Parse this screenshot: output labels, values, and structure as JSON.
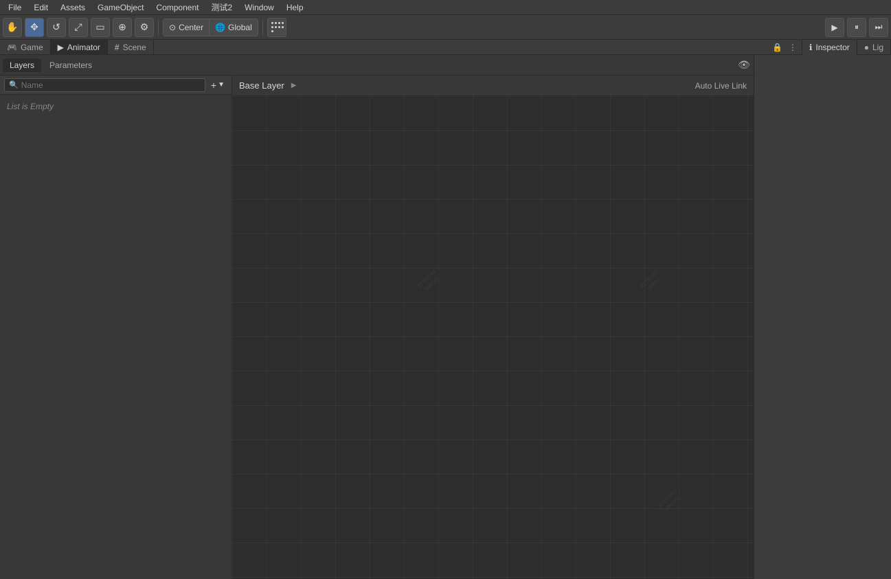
{
  "menubar": {
    "items": [
      "File",
      "Edit",
      "Assets",
      "GameObject",
      "Component",
      "测试2",
      "Window",
      "Help"
    ]
  },
  "toolbar": {
    "tools": [
      {
        "name": "hand",
        "icon": "✋",
        "tooltip": "Hand Tool"
      },
      {
        "name": "move",
        "icon": "✥",
        "tooltip": "Move Tool"
      },
      {
        "name": "rotate",
        "icon": "↺",
        "tooltip": "Rotate Tool"
      },
      {
        "name": "scale",
        "icon": "⤢",
        "tooltip": "Scale Tool"
      },
      {
        "name": "rect",
        "icon": "▭",
        "tooltip": "Rect Tool"
      },
      {
        "name": "transform",
        "icon": "⊕",
        "tooltip": "Transform Tool"
      },
      {
        "name": "tools",
        "icon": "⚙",
        "tooltip": "Custom Tools"
      }
    ],
    "center_label": "Center",
    "global_label": "Global",
    "play_label": "▶",
    "pause_label": "⏸",
    "step_label": "⏭"
  },
  "tabs": {
    "game_label": "Game",
    "animator_label": "Animator",
    "scene_label": "Scene"
  },
  "animator": {
    "subtabs": {
      "layers_label": "Layers",
      "parameters_label": "Parameters"
    },
    "search_placeholder": "Name",
    "base_layer_label": "Base Layer",
    "auto_live_link_label": "Auto Live Link",
    "empty_list_label": "List is Empty"
  },
  "inspector": {
    "label": "Inspector",
    "light_label": "Lig"
  },
  "icons": {
    "search": "🔍",
    "eye": "👁",
    "add": "+",
    "dropdown": "▼",
    "lock": "🔒",
    "more": "⋮",
    "info": "ℹ",
    "bullet": "●"
  }
}
